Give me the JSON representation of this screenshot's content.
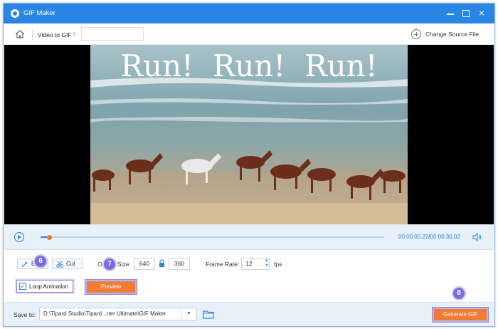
{
  "window": {
    "title": "GIF Maker"
  },
  "nav": {
    "breadcrumb": "Video to GIF",
    "name_value": "",
    "change_source": "Change Source File"
  },
  "video": {
    "overlay_text": "Run!  Run!  Run!"
  },
  "player": {
    "current_time": "00:00:00.22",
    "separator": "/",
    "total_time": "00:00:30.02",
    "progress": 0.025
  },
  "settings": {
    "edit_label": "Edit",
    "cut_label": "Cut",
    "output_size_label": "Output Size:",
    "width": "640",
    "height": "360",
    "frame_rate_label": "Frame Rate:",
    "frame_rate": "12",
    "fps_label": "fps",
    "loop_label": "Loop Animation",
    "loop_checked": true,
    "preview_label": "Preview"
  },
  "save": {
    "label": "Save to:",
    "path": "D:\\Tipard Studio\\Tipard...rter Ultimate\\GIF Maker",
    "generate_label": "Generate GIF"
  },
  "markers": {
    "m6": "6",
    "m7": "7",
    "m8": "8"
  },
  "colors": {
    "accent": "#2a86e5",
    "action": "#f27b36",
    "marker": "#7a6be0",
    "marker_border": "#cfc9f5"
  }
}
